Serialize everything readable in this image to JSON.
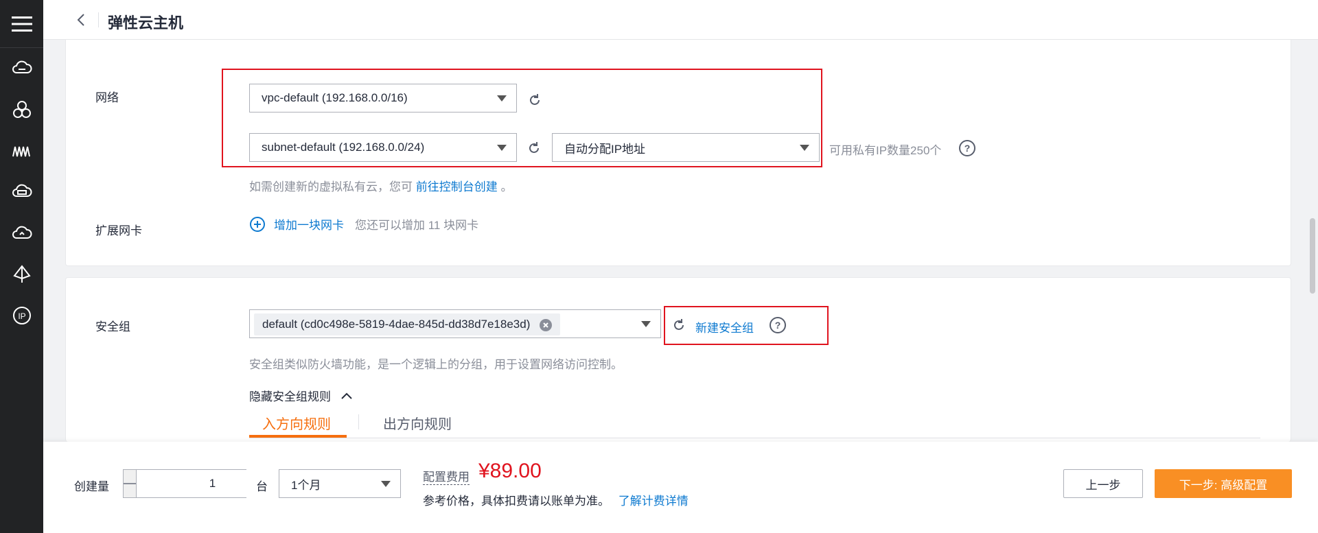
{
  "header": {
    "title": "弹性云主机"
  },
  "network": {
    "label": "网络",
    "vpc_select": "vpc-default (192.168.0.0/16)",
    "subnet_select": "subnet-default (192.168.0.0/24)",
    "ip_select": "自动分配IP地址",
    "available_ips": "可用私有IP数量250个",
    "hint_prefix": "如需创建新的虚拟私有云，您可",
    "hint_link": "前往控制台创建",
    "hint_suffix": "。"
  },
  "nic": {
    "label": "扩展网卡",
    "add_link": "增加一块网卡",
    "remaining": "您还可以增加 11 块网卡"
  },
  "security_group": {
    "label": "安全组",
    "selected": "default (cd0c498e-5819-4dae-845d-dd38d7e18e3d)",
    "new_link": "新建安全组",
    "hint": "安全组类似防火墙功能，是一个逻辑上的分组，用于设置网络访问控制。",
    "hide_rules": "隐藏安全组规则",
    "tabs": [
      "入方向规则",
      "出方向规则"
    ],
    "active_tab": 0
  },
  "footer": {
    "quantity_label": "创建量",
    "quantity_value": "1",
    "unit": "台",
    "duration": "1个月",
    "fee_label": "配置费用",
    "price": "¥89.00",
    "ref_text": "参考价格，具体扣费请以账单为准。",
    "ref_link": "了解计费详情",
    "prev_button": "上一步",
    "next_button": "下一步: 高级配置"
  },
  "sidebar": {
    "icons": [
      "cloud-server-icon",
      "cluster-icon",
      "waves-icon",
      "storage-icon",
      "cloud-icon",
      "network-icon",
      "ip-icon"
    ]
  },
  "colors": {
    "accent": "#f98f24",
    "tab_active": "#f66f0f",
    "link": "#0e7ad0",
    "highlight_box": "#e0131e",
    "price": "#e0131e"
  }
}
